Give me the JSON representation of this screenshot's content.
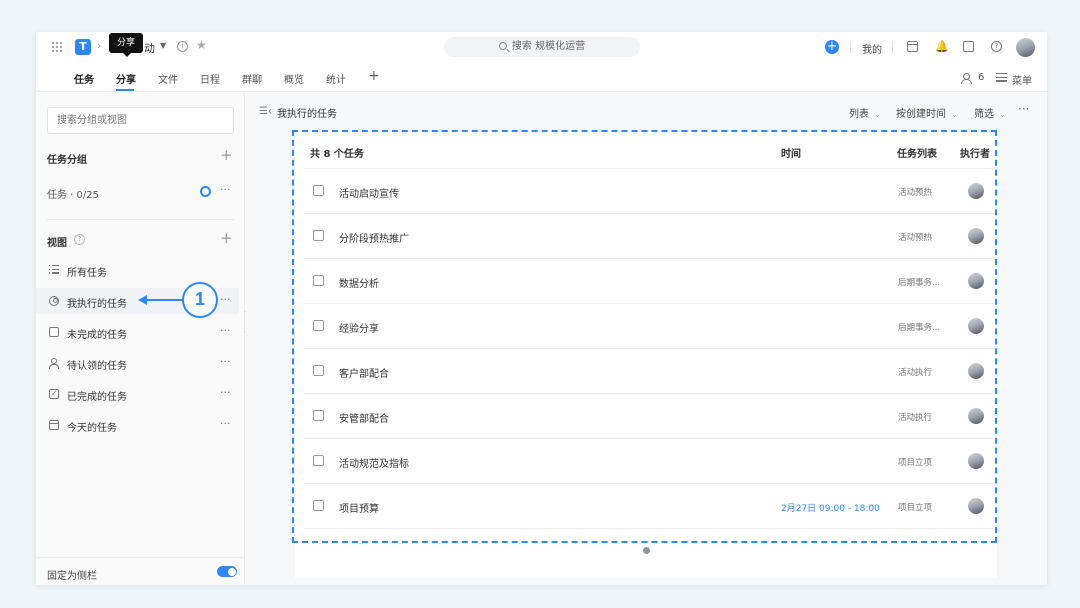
{
  "tooltip": "分享",
  "project_name_visible": "动",
  "search": {
    "label": "搜索 规模化运营"
  },
  "top_right": {
    "my": "我的"
  },
  "nav": {
    "tabs": [
      "任务",
      "分享",
      "文件",
      "日程",
      "群聊",
      "概览",
      "统计"
    ],
    "member_count": "6",
    "menu_label": "菜单"
  },
  "sidebar": {
    "search_placeholder": "搜索分组或视图",
    "groups_title": "任务分组",
    "group_row": "任务 · 0/25",
    "views_title": "视图",
    "views": [
      {
        "label": "所有任务",
        "icon": "list-icon"
      },
      {
        "label": "我执行的任务",
        "icon": "user-circle-icon"
      },
      {
        "label": "未完成的任务",
        "icon": "checkbox-icon"
      },
      {
        "label": "待认领的任务",
        "icon": "person-icon"
      },
      {
        "label": "已完成的任务",
        "icon": "checked-box-icon"
      },
      {
        "label": "今天的任务",
        "icon": "calendar-icon"
      }
    ],
    "pin_label": "固定为侧栏"
  },
  "callout": {
    "number": "1"
  },
  "main": {
    "title": "我执行的任务",
    "toolbar": {
      "view_mode": "列表",
      "sort": "按创建时间",
      "filter": "筛选"
    },
    "table": {
      "headers": {
        "count": "共 8 个任务",
        "time": "时间",
        "list": "任务列表",
        "assignee": "执行者"
      },
      "rows": [
        {
          "name": "活动启动宣传",
          "time": "",
          "list": "活动预热"
        },
        {
          "name": "分阶段预热推广",
          "time": "",
          "list": "活动预热"
        },
        {
          "name": "数据分析",
          "time": "",
          "list": "后期事务..."
        },
        {
          "name": "经验分享",
          "time": "",
          "list": "后期事务..."
        },
        {
          "name": "客户部配合",
          "time": "",
          "list": "活动执行"
        },
        {
          "name": "安管部配合",
          "time": "",
          "list": "活动执行"
        },
        {
          "name": "活动规范及指标",
          "time": "",
          "list": "项目立项"
        },
        {
          "name": "项目预算",
          "time": "2月27日 09:00 - 18:00",
          "list": "项目立项"
        }
      ]
    }
  },
  "colors": {
    "accent": "#2f86f6",
    "background": "#eef4f8"
  }
}
